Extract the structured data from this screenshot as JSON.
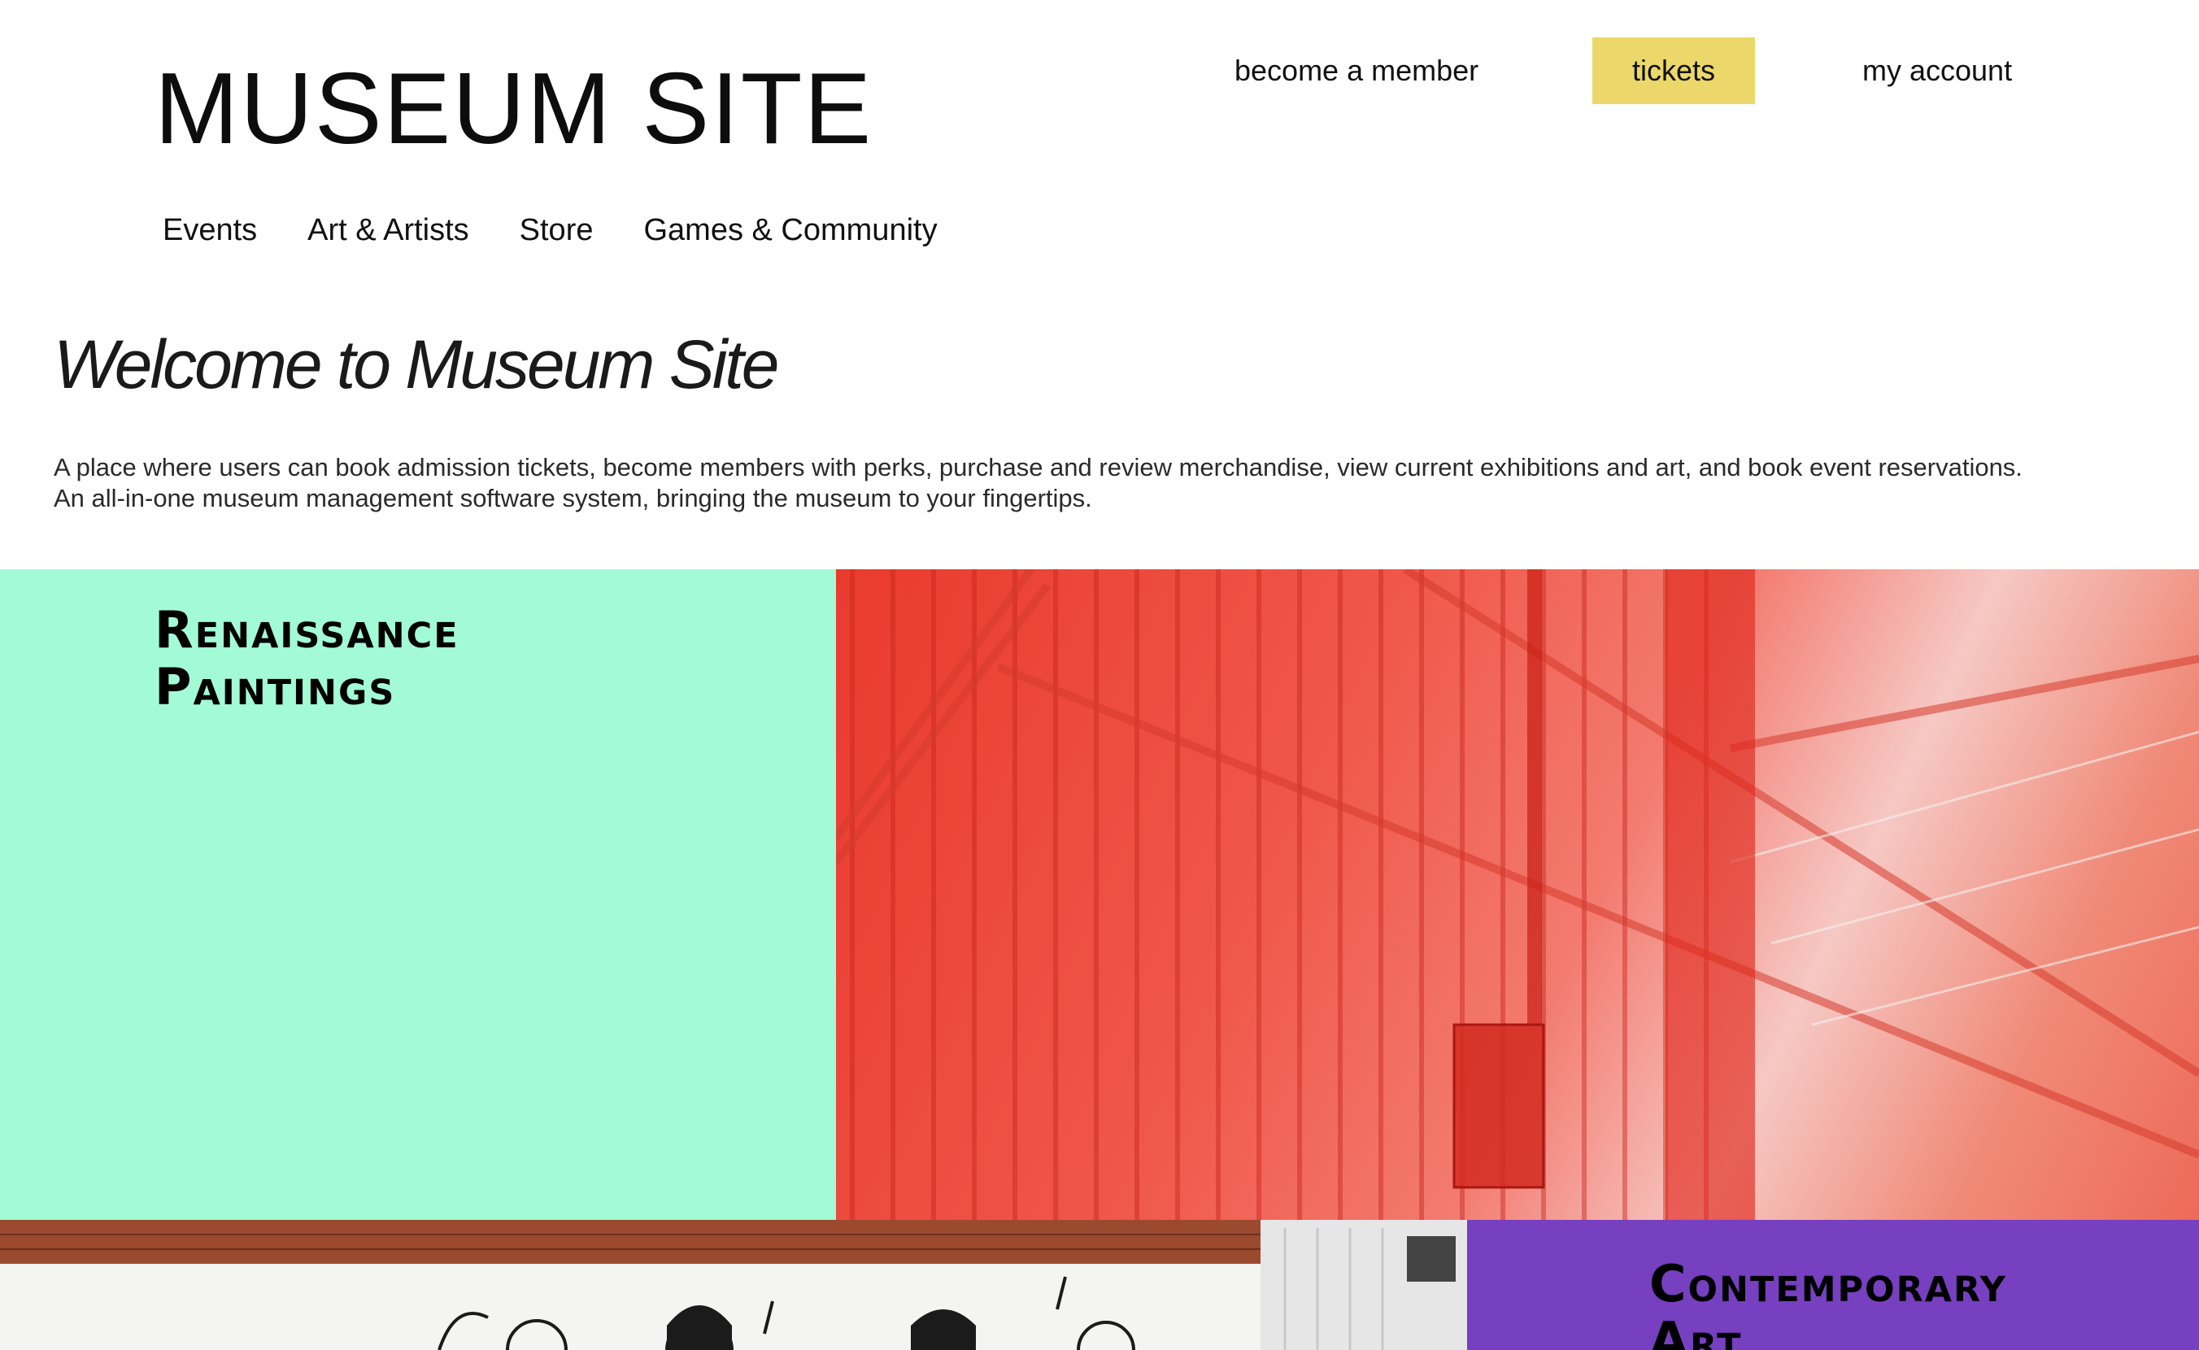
{
  "header": {
    "site_title": "MUSEUM SITE",
    "top_links": {
      "member": "become a member",
      "tickets": "tickets",
      "account": "my account"
    },
    "nav": [
      "Events",
      "Art & Artists",
      "Store",
      "Games & Community"
    ]
  },
  "hero": {
    "welcome": "Welcome to Museum Site",
    "intro_line1": "A place where users can book admission tickets, become members with perks, purchase and review merchandise, view current exhibitions and art, and book event reservations.",
    "intro_line2": "An all-in-one museum management software system, bringing the museum to your fingertips."
  },
  "tiles": {
    "renaissance": {
      "line1": "Renaissance",
      "line2": "Paintings"
    },
    "contemporary": {
      "line1": "Contemporary",
      "line2": "Art"
    }
  },
  "colors": {
    "tickets_bg": "#ecd86a",
    "renaissance_bg": "#a2fbd6",
    "contemporary_bg": "#7640c0"
  }
}
